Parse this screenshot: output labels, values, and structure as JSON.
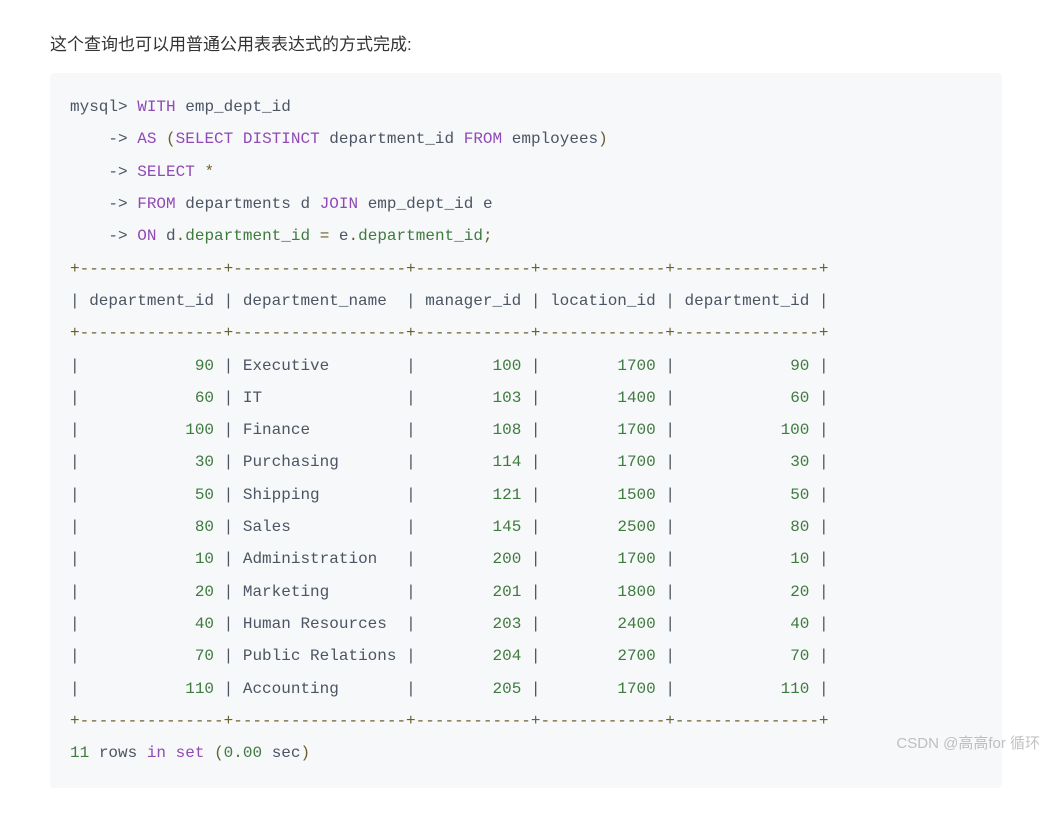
{
  "intro": "这个查询也可以用普通公用表表达式的方式完成:",
  "code": {
    "prompt": "mysql>",
    "arrow": "    ->",
    "line1_kw_with": "WITH",
    "line1_ident": "emp_dept_id",
    "line2_kw_as": "AS",
    "line2_paren_open": "(",
    "line2_kw_select": "SELECT",
    "line2_kw_distinct": "DISTINCT",
    "line2_col": "department_id",
    "line2_kw_from": "FROM",
    "line2_tbl": "employees",
    "line2_paren_close": ")",
    "line3_kw_select": "SELECT",
    "line3_star": "*",
    "line4_kw_from": "FROM",
    "line4_tbl": "departments",
    "line4_alias_d": "d",
    "line4_kw_join": "JOIN",
    "line4_tbl2": "emp_dept_id",
    "line4_alias_e": "e",
    "line5_kw_on": "ON",
    "line5_d": "d",
    "line5_dot1": ".",
    "line5_col1": "department_id",
    "line5_eq": "=",
    "line5_e": "e",
    "line5_dot2": ".",
    "line5_col2": "department_id",
    "line5_semi": ";"
  },
  "table": {
    "border": "+---------------+------------------+------------+-------------+---------------+",
    "header": "| department_id | department_name  | manager_id | location_id | department_id |",
    "rows": [
      {
        "dept_id": 90,
        "name": "Executive",
        "mgr": 100,
        "loc": 1700,
        "dept_id2": 90
      },
      {
        "dept_id": 60,
        "name": "IT",
        "mgr": 103,
        "loc": 1400,
        "dept_id2": 60
      },
      {
        "dept_id": 100,
        "name": "Finance",
        "mgr": 108,
        "loc": 1700,
        "dept_id2": 100
      },
      {
        "dept_id": 30,
        "name": "Purchasing",
        "mgr": 114,
        "loc": 1700,
        "dept_id2": 30
      },
      {
        "dept_id": 50,
        "name": "Shipping",
        "mgr": 121,
        "loc": 1500,
        "dept_id2": 50
      },
      {
        "dept_id": 80,
        "name": "Sales",
        "mgr": 145,
        "loc": 2500,
        "dept_id2": 80
      },
      {
        "dept_id": 10,
        "name": "Administration",
        "mgr": 200,
        "loc": 1700,
        "dept_id2": 10
      },
      {
        "dept_id": 20,
        "name": "Marketing",
        "mgr": 201,
        "loc": 1800,
        "dept_id2": 20
      },
      {
        "dept_id": 40,
        "name": "Human Resources",
        "mgr": 203,
        "loc": 2400,
        "dept_id2": 40
      },
      {
        "dept_id": 70,
        "name": "Public Relations",
        "mgr": 204,
        "loc": 2700,
        "dept_id2": 70
      },
      {
        "dept_id": 110,
        "name": "Accounting",
        "mgr": 205,
        "loc": 1700,
        "dept_id2": 110
      }
    ],
    "footer_count": "11",
    "footer_rows_word": "rows",
    "footer_in": "in",
    "footer_set": "set",
    "footer_paren_open": "(",
    "footer_time": "0.00",
    "footer_sec": "sec",
    "footer_paren_close": ")"
  },
  "watermark": "CSDN @高高for 循环"
}
